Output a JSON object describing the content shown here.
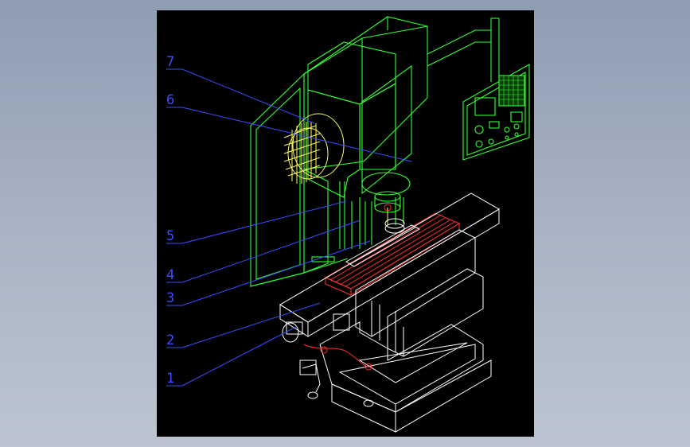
{
  "colors": {
    "background_gradient": [
      "#8f9db2",
      "#bcc4d1"
    ],
    "drawing_bg": "#000000",
    "machine_lines": "#33ff33",
    "tool_lines": "#ffff66",
    "table_lines": "#ff3030",
    "leader_lines": "#3d4dff",
    "base_lines": "#ffffff"
  },
  "callouts": [
    {
      "label": "7"
    },
    {
      "label": "6"
    },
    {
      "label": "5"
    },
    {
      "label": "4"
    },
    {
      "label": "3"
    },
    {
      "label": "2"
    },
    {
      "label": "1"
    }
  ]
}
